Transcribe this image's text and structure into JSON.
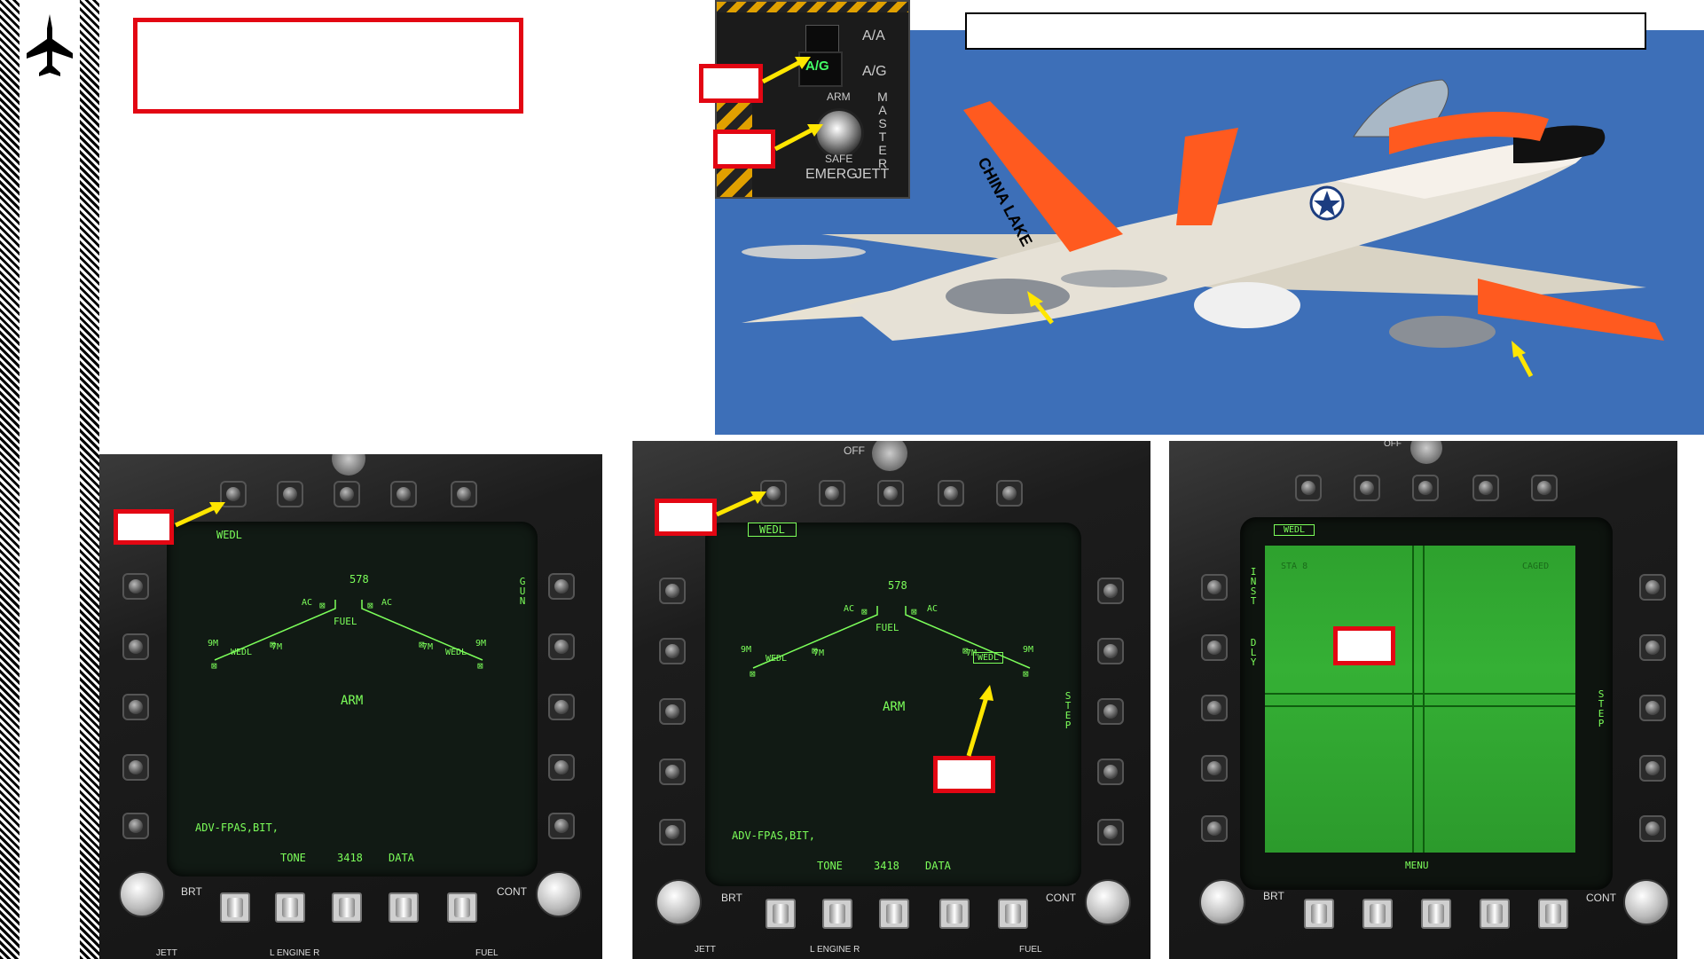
{
  "sidebar": {
    "icon": "fighter-jet-silhouette-icon"
  },
  "title_box_text": "",
  "header_bar_text": "",
  "master_arm_panel": {
    "labels": [
      "A/A",
      "A/G",
      "ARM",
      "SAFE",
      "MASTER",
      "EMERG",
      "JETT"
    ]
  },
  "aircraft": {
    "tail_text": "CHINA LAKE"
  },
  "ddi_1": {
    "top_label": "WEDL",
    "number": "578",
    "ac_left": "AC",
    "ac_right": "AC",
    "fuel": "FUEL",
    "nine_m_left": "9M",
    "nine_m_right": "9M",
    "seven_m_left": "7M",
    "seven_m_right": "7M",
    "wedl_left": "WEDL",
    "wedl_right": "WEDL",
    "arm": "ARM",
    "side_label": "GUN",
    "adv": "ADV-FPAS,BIT,",
    "tone": "TONE",
    "code": "3418",
    "data": "DATA",
    "brt": "BRT",
    "cont": "CONT",
    "bottom_labels": [
      "JETT",
      "L ENGINE R",
      "FUEL"
    ]
  },
  "ddi_2": {
    "top_label": "WEDL",
    "number": "578",
    "ac_left": "AC",
    "ac_right": "AC",
    "fuel": "FUEL",
    "nine_m_left": "9M",
    "nine_m_right": "9M",
    "seven_m_left": "7M",
    "seven_m_right": "7M",
    "wedl_left": "WEDL",
    "wedl_right": "WEDL",
    "arm": "ARM",
    "side_label": "STEP",
    "adv": "ADV-FPAS,BIT,",
    "tone": "TONE",
    "code": "3418",
    "data": "DATA",
    "brt": "BRT",
    "cont": "CONT",
    "off": "OFF",
    "bottom_labels": [
      "JETT",
      "L ENGINE R",
      "FUEL"
    ]
  },
  "ddi_3": {
    "top_label": "WEDL",
    "sta": "STA 8",
    "caged": "CAGED",
    "side_left_1": "INST",
    "side_left_2": "DLY",
    "side_right": "STEP",
    "menu": "MENU",
    "brt": "BRT",
    "cont": "CONT",
    "off": "OFF"
  },
  "colors": {
    "callout_red": "#e30613",
    "arrow_yellow": "#ffe600",
    "hud_green": "#7cff5a",
    "sky_blue": "#3d6fb8"
  }
}
